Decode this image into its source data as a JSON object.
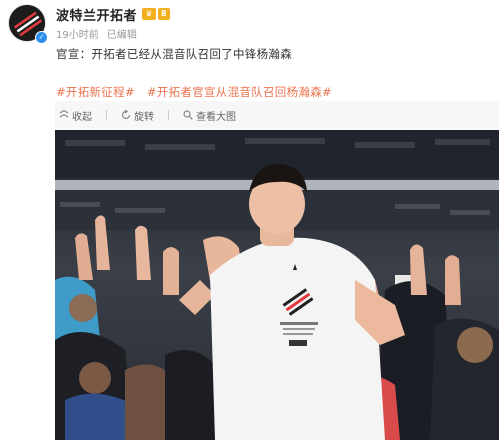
{
  "post": {
    "author": "波特兰开拓者",
    "level_badge": "8",
    "time": "19小时前",
    "edited": "已编辑",
    "text": "官宣：开拓者已经从混音队召回了中锋杨瀚森",
    "hashtags": [
      "#开拓新征程#",
      "#开拓者官宣从混音队召回杨瀚森#"
    ]
  },
  "toolbar": {
    "collapse": "收起",
    "rotate": "旋转",
    "view_large": "查看大图"
  },
  "colors": {
    "link": "#eb7350",
    "verified": "#2e8ff0",
    "badge": "#f2b01e"
  }
}
